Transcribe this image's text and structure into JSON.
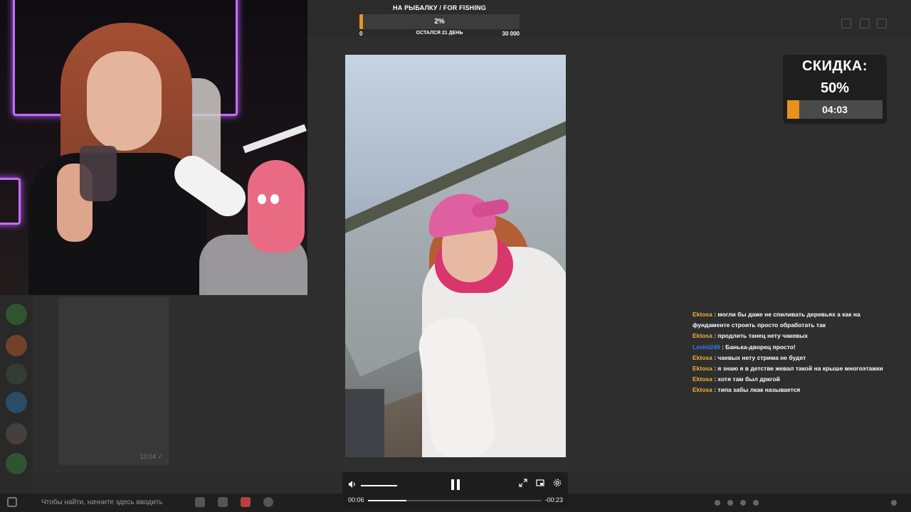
{
  "goal": {
    "title": "НА РЫБАЛКУ / FOR FISHING",
    "percent_label": "2%",
    "progress": 0.02,
    "min": "0",
    "remaining": "ОСТАЛСЯ 21 ДЕНЬ",
    "max": "30 000",
    "accent_color": "#e8921a"
  },
  "discount": {
    "title": "СКИДКА:",
    "value": "50%",
    "timer": "04:03",
    "progress": 0.13,
    "accent_color": "#e8921a"
  },
  "player": {
    "current_time": "00:06",
    "remaining_time": "-00:23",
    "progress": 0.22,
    "volume": 1.0,
    "icons": [
      "volume-icon",
      "pause-icon",
      "fullscreen-icon",
      "pip-icon",
      "settings-icon"
    ]
  },
  "chat": {
    "messages": [
      {
        "user": "Ektosa",
        "color": "#f0b23a",
        "text": "могли бы даже не спиливать деревьях а как на фундаменте строить просто обработать так"
      },
      {
        "user": "Ektosa",
        "color": "#f0b23a",
        "text": "продлить танец нету чакевых"
      },
      {
        "user": "Leshii249",
        "color": "#3a78f0",
        "text": "Банька-дворец просто!"
      },
      {
        "user": "Ektosa",
        "color": "#f0b23a",
        "text": "чаевых нету стрима не будет"
      },
      {
        "user": "Ektosa",
        "color": "#f0b23a",
        "text": "я знаю я в детстве жевал такой на крыше многоэтажки"
      },
      {
        "user": "Ektosa",
        "color": "#f0b23a",
        "text": "хотя там был дркгой"
      },
      {
        "user": "Ektosa",
        "color": "#f0b23a",
        "text": "типа забы лкак называется"
      }
    ]
  },
  "taskbar": {
    "search_placeholder": "Чтобы найти, начните здесь вводить"
  }
}
